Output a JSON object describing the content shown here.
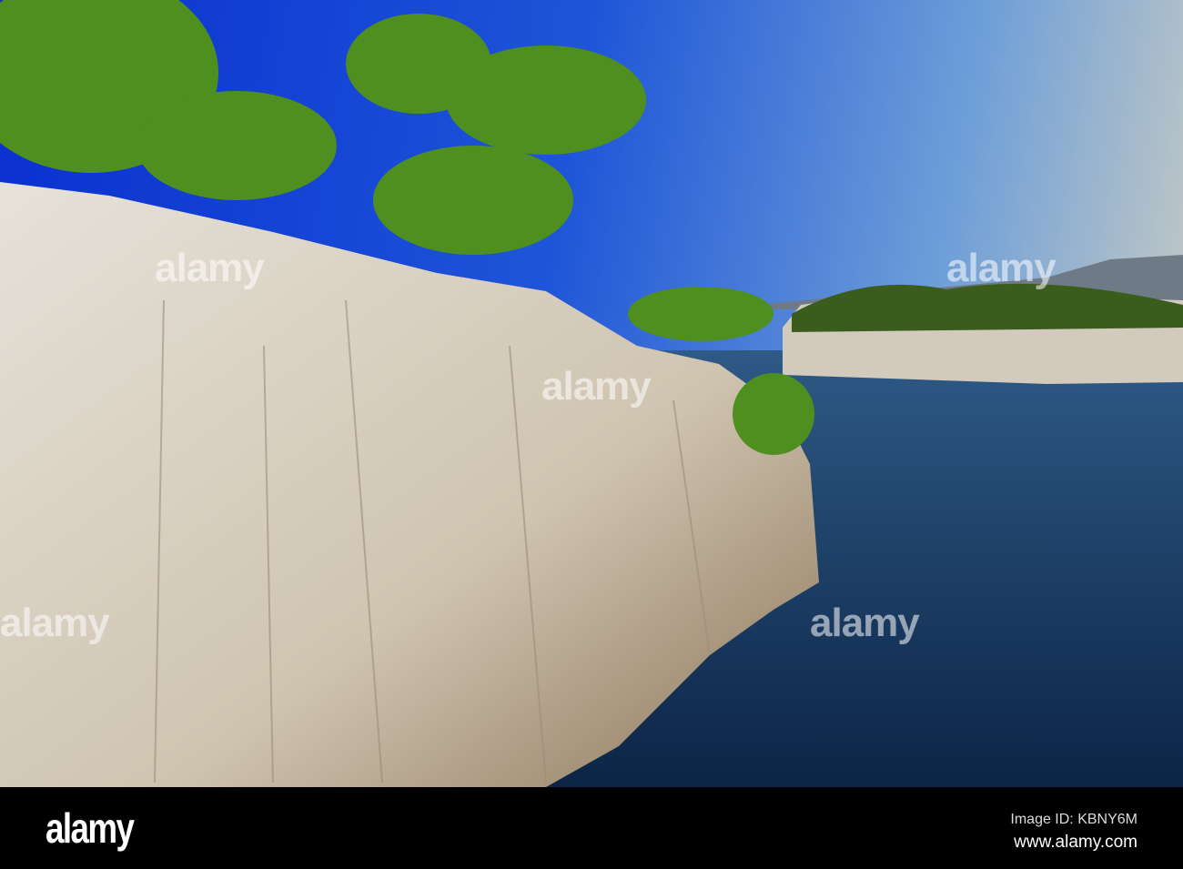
{
  "watermark": "alamy",
  "footer": {
    "logo": "alamy",
    "image_id": "Image ID: KBNY6M",
    "url": "www.alamy.com"
  }
}
